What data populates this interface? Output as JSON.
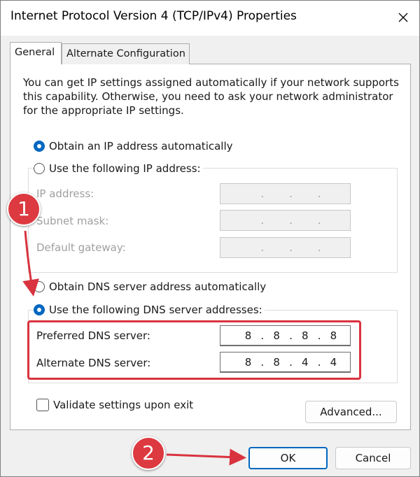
{
  "window": {
    "title": "Internet Protocol Version 4 (TCP/IPv4) Properties"
  },
  "tabs": [
    {
      "label": "General",
      "selected": true
    },
    {
      "label": "Alternate Configuration",
      "selected": false
    }
  ],
  "intro_text": "You can get IP settings assigned automatically if your network supports this capability. Otherwise, you need to ask your network administrator for the appropriate IP settings.",
  "ip_section": {
    "radio_auto": {
      "label": "Obtain an IP address automatically",
      "selected": true
    },
    "radio_manual": {
      "label": "Use the following IP address:",
      "selected": false
    },
    "fields": [
      {
        "label": "IP address:",
        "octets": [
          "",
          "",
          "",
          ""
        ],
        "enabled": false
      },
      {
        "label": "Subnet mask:",
        "octets": [
          "",
          "",
          "",
          ""
        ],
        "enabled": false
      },
      {
        "label": "Default gateway:",
        "octets": [
          "",
          "",
          "",
          ""
        ],
        "enabled": false
      }
    ]
  },
  "dns_section": {
    "radio_auto": {
      "label": "Obtain DNS server address automatically",
      "selected": false
    },
    "radio_manual": {
      "label": "Use the following DNS server addresses:",
      "selected": true
    },
    "preferred": {
      "label": "Preferred DNS server:",
      "octets": [
        "8",
        "8",
        "8",
        "8"
      ]
    },
    "alternate": {
      "label": "Alternate DNS server:",
      "octets": [
        "8",
        "8",
        "4",
        "4"
      ]
    }
  },
  "validate_checkbox": {
    "label": "Validate settings upon exit",
    "checked": false
  },
  "buttons": {
    "advanced": "Advanced...",
    "ok": "OK",
    "cancel": "Cancel"
  },
  "annotations": {
    "step1": "1",
    "step2": "2",
    "accent_color": "#dc3a40"
  },
  "colors": {
    "accent": "#0067c0",
    "annotation": "#d9333f"
  }
}
